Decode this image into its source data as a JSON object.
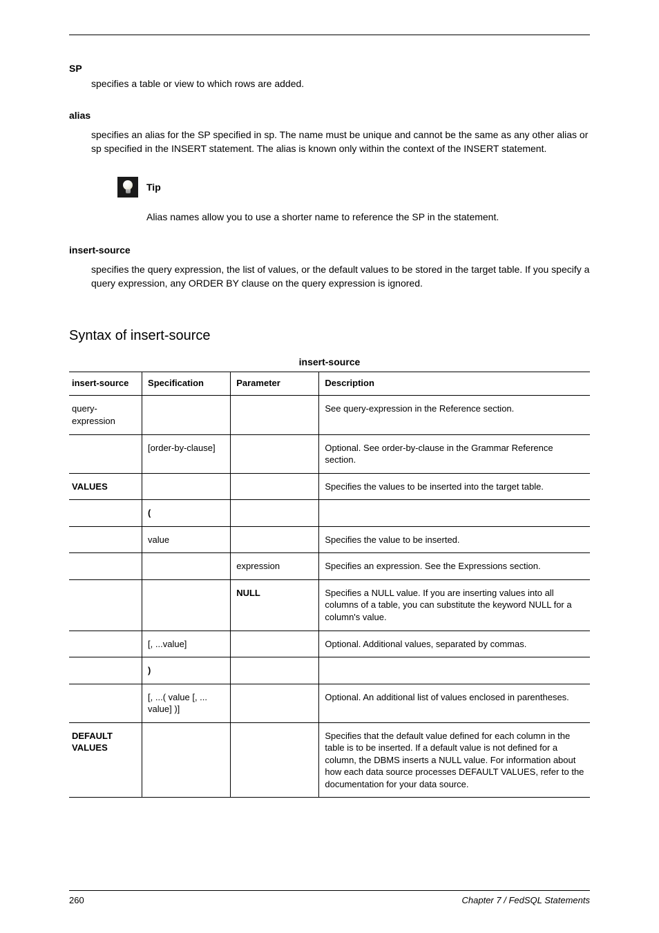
{
  "sp": {
    "label": "SP",
    "text": "specifies a table or view to which rows are added."
  },
  "alias": {
    "label": "alias",
    "text": "specifies an alias for the SP specified in sp. The name must be unique and cannot be the same as any other alias or sp specified in the INSERT statement. The alias is known only within the context of the INSERT statement."
  },
  "tip_label": "Tip",
  "tip_body": "Alias names allow you to use a shorter name to reference the SP in the statement.",
  "insert_source": {
    "label": "insert-source",
    "text": "specifies the query expression, the list of values, or the default values to be stored in the target table. If you specify a query expression, any ORDER BY clause on the query expression is ignored."
  },
  "sec_head": "Syntax of insert-source",
  "table_title": "insert-source",
  "columns": {
    "c1": "insert-source",
    "c2": "Specification",
    "c3": "Parameter",
    "c4": "Description"
  },
  "rows": [
    {
      "c1": "query-expression",
      "c2": "",
      "c3": "",
      "c4": "See query-expression in the Reference section."
    },
    {
      "c1": "",
      "c2": "[order-by-clause]",
      "c3": "",
      "c4": "Optional. See order-by-clause in the Grammar Reference section."
    },
    {
      "c1": "VALUES",
      "c2": "",
      "c3": "",
      "c4": "Specifies the values to be inserted into the target table."
    },
    {
      "c1": "",
      "c2": "(",
      "c3": "",
      "c4": ""
    },
    {
      "c1": "",
      "c2": "value",
      "c3": "",
      "c4": "Specifies the value to be inserted."
    },
    {
      "c1": "",
      "c2": "",
      "c3": "expression",
      "c4": "Specifies an expression. See the Expressions section."
    },
    {
      "c1": "",
      "c2": "",
      "c3": "NULL",
      "c4": "Specifies a NULL value. If you are inserting values into all columns of a table, you can substitute the keyword NULL for a column's value."
    },
    {
      "c1": "",
      "c2": "[, ...value]",
      "c3": "",
      "c4": "Optional. Additional values, separated by commas."
    },
    {
      "c1": "",
      "c2": ")",
      "c3": "",
      "c4": ""
    },
    {
      "c1": "",
      "c2": "[, ...( value [, ... value] )]",
      "c3": "",
      "c4": "Optional. An additional list of values enclosed in parentheses."
    },
    {
      "c1": "DEFAULT VALUES",
      "c2": "",
      "c3": "",
      "c4": "Specifies that the default value defined for each column in the table is to be inserted. If a default value is not defined for a column, the DBMS inserts a NULL value. For information about how each data source processes DEFAULT VALUES, refer to the documentation for your data source."
    }
  ],
  "page_num": "260",
  "chapter": "Chapter 7 / FedSQL Statements"
}
